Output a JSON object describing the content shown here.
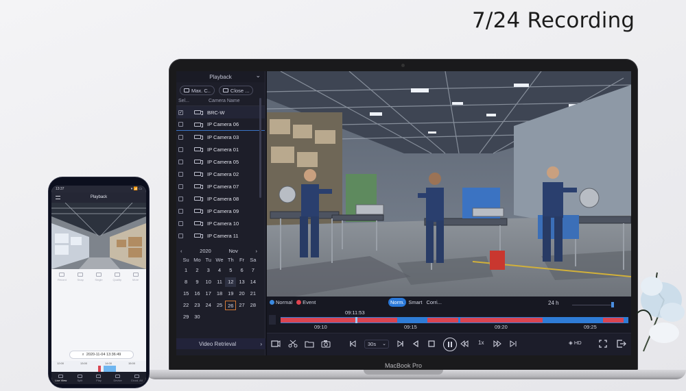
{
  "headline": "7/24 Recording",
  "laptop": {
    "label": "MacBook Pro"
  },
  "sidebar": {
    "title": "Playback",
    "tools": [
      {
        "label": "Max. C..",
        "icon": "camera-icon"
      },
      {
        "label": "Close ...",
        "icon": "close-camera-icon"
      }
    ],
    "columns": {
      "select": "Sel...",
      "name": "Camera Name"
    },
    "cameras": [
      {
        "name": "BRC-W",
        "checked": true
      },
      {
        "name": "IP Camera 06",
        "checked": false
      },
      {
        "name": "IP Camera 03",
        "checked": false
      },
      {
        "name": "IP Camera 01",
        "checked": false
      },
      {
        "name": "IP Camera 05",
        "checked": false
      },
      {
        "name": "IP Camera 02",
        "checked": false
      },
      {
        "name": "IP Camera 07",
        "checked": false
      },
      {
        "name": "IP Camera 08",
        "checked": false
      },
      {
        "name": "IP Camera 09",
        "checked": false
      },
      {
        "name": "IP Camera 10",
        "checked": false
      },
      {
        "name": "IP Camera 11",
        "checked": false
      }
    ],
    "calendar": {
      "prev": "‹",
      "year": "2020",
      "month": "Nov",
      "next": "›",
      "weekdays": [
        "Su",
        "Mo",
        "Tu",
        "We",
        "Th",
        "Fr",
        "Sa"
      ],
      "days": [
        "1",
        "2",
        "3",
        "4",
        "5",
        "6",
        "7",
        "8",
        "9",
        "10",
        "11",
        "12",
        "13",
        "14",
        "15",
        "16",
        "17",
        "18",
        "19",
        "20",
        "21",
        "22",
        "23",
        "24",
        "25",
        "26",
        "27",
        "28",
        "29",
        "30"
      ],
      "first_weekday": 0,
      "recorded_day": "12",
      "selected_day": "26"
    },
    "retrieval": {
      "label": "Video Retrieval",
      "arrow": "›"
    }
  },
  "timeline": {
    "legend": [
      {
        "label": "Normal",
        "color": "#3b8ae0"
      },
      {
        "label": "Event",
        "color": "#e0434f"
      }
    ],
    "modes": [
      "Norm.",
      "Smart",
      "Corri..."
    ],
    "active_mode": "Norm.",
    "span": "24 h",
    "cursor_time": "09:11:53",
    "ticks": [
      "09:10",
      "09:15",
      "09:20",
      "09:25"
    ],
    "colors": {
      "normal": "#2f7cd6",
      "event": "#d94552"
    }
  },
  "controls": {
    "speed": "30s",
    "speed_arrow": "⌄",
    "rate": "1x",
    "quality": "HD",
    "quality_icon": "◈"
  },
  "phone": {
    "status_time": "13:37",
    "status_right": "▾ 📶 ▭",
    "title": "Playback",
    "tabs": [
      "Record",
      "Snap",
      "Single",
      "Quality",
      "More"
    ],
    "date_value": "2020-11-04 13:36:49",
    "timeline_ticks": [
      "12:00",
      "13:00",
      "14:00",
      "15:00"
    ],
    "nav": [
      "Live View",
      "Split",
      "Play",
      "Device",
      "Cloud, All"
    ]
  }
}
